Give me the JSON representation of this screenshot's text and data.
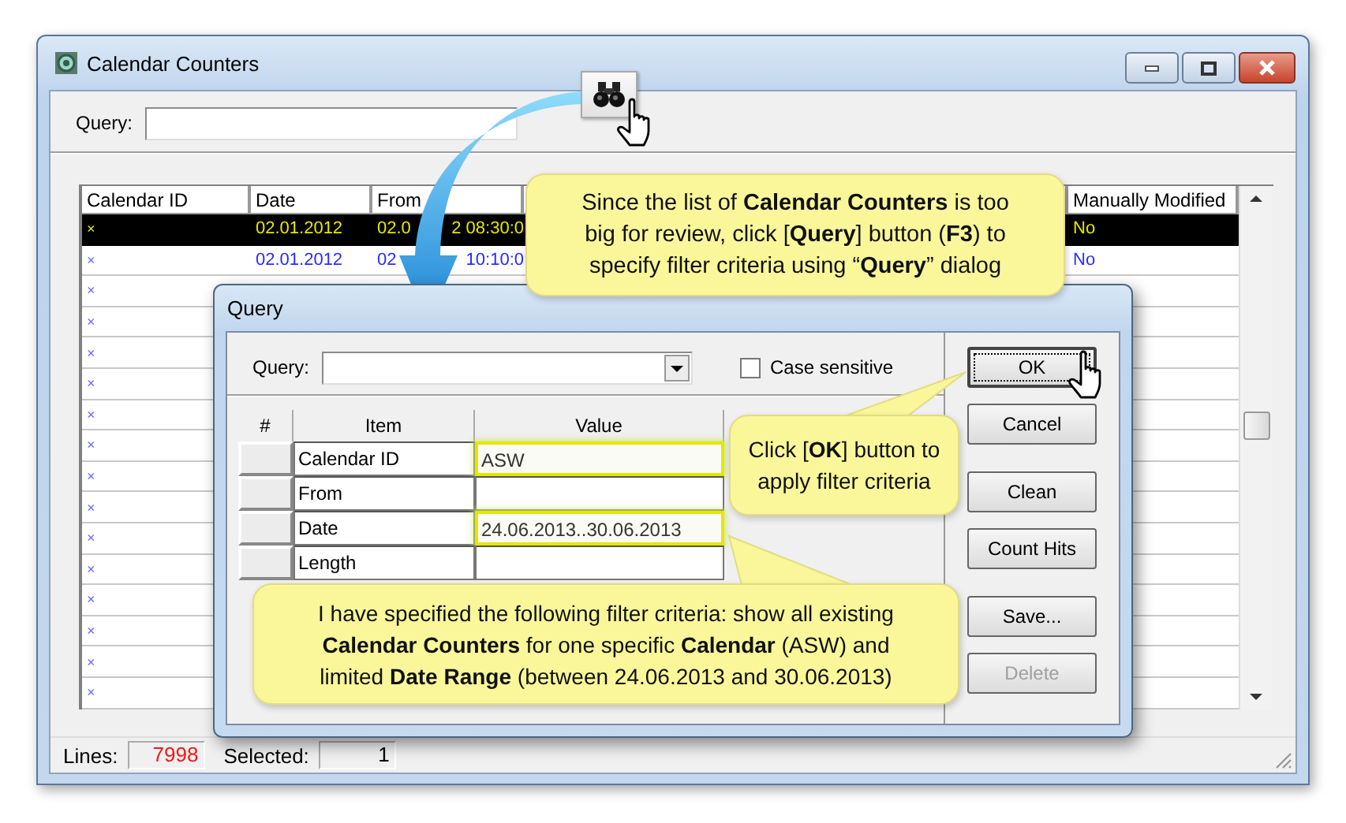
{
  "window": {
    "title": "Calendar Counters"
  },
  "query": {
    "label": "Query:"
  },
  "table": {
    "columns": [
      "Calendar ID",
      "Date",
      "From",
      "Manually Modified"
    ],
    "rows": [
      {
        "selected": true,
        "calendar_id": "×",
        "date": "02.01.2012",
        "from": [
          "02.0",
          "2 08:30:0"
        ],
        "manually_modified": "No"
      },
      {
        "selected": false,
        "calendar_id": "×",
        "date": "02.01.2012",
        "from": [
          "02",
          "10:10:0"
        ],
        "manually_modified": "No"
      },
      {
        "selected": false,
        "calendar_id": "×"
      },
      {
        "selected": false,
        "calendar_id": "×"
      },
      {
        "selected": false,
        "calendar_id": "×"
      },
      {
        "selected": false,
        "calendar_id": "×"
      },
      {
        "selected": false,
        "calendar_id": "×"
      },
      {
        "selected": false,
        "calendar_id": "×"
      },
      {
        "selected": false,
        "calendar_id": "×"
      },
      {
        "selected": false,
        "calendar_id": "×"
      },
      {
        "selected": false,
        "calendar_id": "×"
      },
      {
        "selected": false,
        "calendar_id": "×"
      },
      {
        "selected": false,
        "calendar_id": "×"
      },
      {
        "selected": false,
        "calendar_id": "×"
      },
      {
        "selected": false,
        "calendar_id": "×"
      },
      {
        "selected": false,
        "calendar_id": "×"
      }
    ]
  },
  "status_bar": {
    "lines_label": "Lines:",
    "lines": "7998",
    "selected_label": "Selected:",
    "selected_count": "1"
  },
  "dialog": {
    "title": "Query",
    "query_label": "Query:",
    "case_sensitive": {
      "label": "Case sensitive",
      "checked": false
    },
    "columns": [
      "#",
      "Item",
      "Value"
    ],
    "rows": [
      {
        "item": "Calendar ID",
        "value": "ASW",
        "highlighted": true
      },
      {
        "item": "From",
        "highlighted": false
      },
      {
        "item": "Date",
        "value": "24.06.2013..30.06.2013",
        "highlighted": true
      },
      {
        "item": "Length",
        "highlighted": false
      }
    ],
    "buttons": [
      {
        "label": "OK",
        "disabled": false
      },
      {
        "label": "Cancel",
        "disabled": false
      },
      {
        "label": "Clean",
        "disabled": false
      },
      {
        "label": "Count Hits",
        "disabled": false
      },
      {
        "label": "Save...",
        "disabled": false
      },
      {
        "label": "Delete",
        "disabled": true
      }
    ]
  },
  "callouts": [
    {
      "text": "Since the list of **Calendar Counters** is too\nbig for review, click [**Query**] button (**F3**) to\nspecify filter criteria using “**Query**” dialog"
    },
    {
      "text": "Click [**OK**] button to\napply filter criteria"
    },
    {
      "text": "I have specified the following filter criteria: show all existing\n**Calendar Counters** for one specific **Calendar** (ASW) and\nlimited **Date Range** (between 24.06.2013 and 30.06.2013)"
    }
  ]
}
